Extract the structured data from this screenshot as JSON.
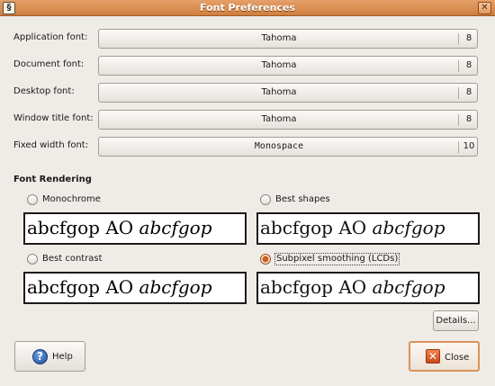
{
  "window": {
    "title": "Font Preferences",
    "app_icon": "gnome-foot-icon",
    "close_glyph": "✕"
  },
  "fonts": [
    {
      "label": "Application font:",
      "name": "Tahoma",
      "size": "8"
    },
    {
      "label": "Document font:",
      "name": "Tahoma",
      "size": "8"
    },
    {
      "label": "Desktop font:",
      "name": "Tahoma",
      "size": "8"
    },
    {
      "label": "Window title font:",
      "name": "Tahoma",
      "size": "8"
    },
    {
      "label": "Fixed width font:",
      "name": "Monospace",
      "size": "10"
    }
  ],
  "rendering": {
    "title": "Font Rendering",
    "selected": "Subpixel smoothing (LCDs)",
    "sample_regular": "abcfgop AO ",
    "sample_italic": "abcfgop",
    "options": [
      {
        "label": "Monochrome"
      },
      {
        "label": "Best shapes"
      },
      {
        "label": "Best contrast"
      },
      {
        "label": "Subpixel smoothing (LCDs)"
      }
    ]
  },
  "buttons": {
    "details": "Details...",
    "help": "Help",
    "close": "Close"
  },
  "icons": {
    "help": "help-icon",
    "close": "close-icon"
  },
  "colors": {
    "titlebar": "#cf7f3f",
    "window_bg": "#efebe7",
    "selected_radio": "#c95f1a"
  }
}
